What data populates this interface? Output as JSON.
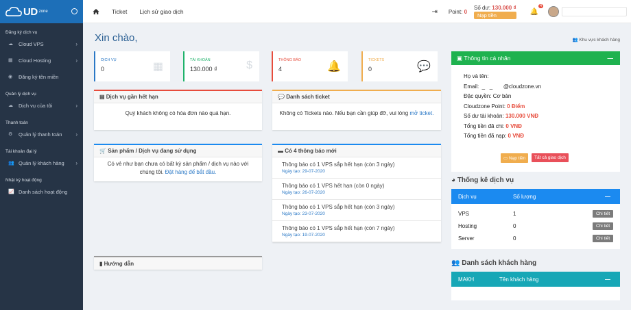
{
  "brand": {
    "logo_text": "UD",
    "logo_sub": "zone"
  },
  "sidebar": {
    "sections": [
      {
        "heading": "Đăng ký dịch vụ",
        "items": [
          {
            "label": "Cloud VPS",
            "icon": "cloud-icon",
            "chevron": true
          },
          {
            "label": "Cloud Hosting",
            "icon": "server-icon",
            "chevron": true
          },
          {
            "label": "Đăng ký tên miền",
            "icon": "globe-icon",
            "chevron": false
          }
        ]
      },
      {
        "heading": "Quản lý dịch vụ",
        "items": [
          {
            "label": "Dịch vụ của tôi",
            "icon": "cloud-icon",
            "chevron": true
          }
        ]
      },
      {
        "heading": "Thanh toán",
        "items": [
          {
            "label": "Quản lý thanh toán",
            "icon": "gear-icon",
            "chevron": true
          }
        ]
      },
      {
        "heading": "Tài khoản đại lý",
        "items": [
          {
            "label": "Quản lý khách hàng",
            "icon": "users-icon",
            "chevron": true
          }
        ]
      },
      {
        "heading": "Nhật ký hoạt động",
        "items": [
          {
            "label": "Danh sách hoạt động",
            "icon": "chart-icon",
            "chevron": false
          }
        ]
      }
    ]
  },
  "topbar": {
    "nav": [
      "Ticket",
      "Lịch sử giao dịch"
    ],
    "point_label": "Point:",
    "point_value": "0",
    "balance_label": "Số dư:",
    "balance_value": "130.000 ₫",
    "topup": "Nạp tiền",
    "notif_count": "4"
  },
  "main": {
    "greeting": "Xin chào,",
    "region_link": "Khu vực khách hàng",
    "stats": [
      {
        "label": "DỊCH VỤ",
        "value": "0",
        "color": "#2a78c6",
        "icon": "calendar-icon"
      },
      {
        "label": "TÀI KHOẢN",
        "value": "130.000 ₫",
        "color": "#1fb26b",
        "icon": "dollar-icon"
      },
      {
        "label": "THÔNG BÁO",
        "value": "4",
        "color": "#e74c3c",
        "icon": "bell-icon"
      },
      {
        "label": "TICKETS",
        "value": "0",
        "color": "#f0ad4e",
        "icon": "comments-icon"
      }
    ],
    "expiring": {
      "title": "Dịch vụ gần hết hạn",
      "body": "Quý khách không có hóa đơn nào quá hạn."
    },
    "tickets": {
      "title": "Danh sách ticket",
      "body": "Không có Tickets nào. Nếu bạn cần giúp đỡ, vui lòng",
      "link": "mở ticket."
    },
    "products": {
      "title": "Sản phẩm / Dịch vụ đang sử dụng",
      "body": "Có vẻ như bạn chưa có bất kỳ sản phẩm / dịch vụ nào với chúng tôi.",
      "link": "Đặt hàng để bắt đầu."
    },
    "notices": {
      "title": "Có 4 thông báo mới",
      "items": [
        {
          "text": "Thông báo có 1 VPS sắp hết hạn (còn 3 ngày)",
          "date": "Ngày tạo: 29-07-2020"
        },
        {
          "text": "Thông báo có 1 VPS hết hạn (còn 0 ngày)",
          "date": "Ngày tạo: 26-07-2020"
        },
        {
          "text": "Thông báo có 1 VPS sắp hết hạn (còn 3 ngày)",
          "date": "Ngày tạo: 23-07-2020"
        },
        {
          "text": "Thông báo có 1 VPS sắp hết hạn (còn 7 ngày)",
          "date": "Ngày tạo: 19-07-2020"
        }
      ]
    },
    "guide": {
      "title": "Hướng dẫn"
    }
  },
  "profile": {
    "title": "Thông tin cá nhân",
    "name_label": "Họ và tên:",
    "email_label": "Email:",
    "email_value": "@cloudzone.vn",
    "privilege_label": "Đặc quyền:",
    "privilege_value": "Cơ bản",
    "point_label": "Cloudzone Point:",
    "point_value": "0 Điểm",
    "balance_label": "Số dư tài khoản:",
    "balance_value": "130.000 VNĐ",
    "spent_label": "Tổng tiền đã chi:",
    "spent_value": "0 VNĐ",
    "deposit_label": "Tổng tiền đã nạp:",
    "deposit_value": "0 VNĐ",
    "btn_topup": "Nạp tiền",
    "btn_all": "Tất cả giao dịch"
  },
  "service_stats": {
    "title": "Thống kê dịch vụ",
    "col1": "Dịch vụ",
    "col2": "Số lượng",
    "rows": [
      {
        "name": "VPS",
        "count": "1",
        "action": "Chi tiết"
      },
      {
        "name": "Hosting",
        "count": "0",
        "action": "Chi tiết"
      },
      {
        "name": "Server",
        "count": "0",
        "action": "Chi tiết"
      }
    ]
  },
  "customers": {
    "title": "Danh sách khách hàng",
    "col1": "MAKH",
    "col2": "Tên khách hàng"
  }
}
